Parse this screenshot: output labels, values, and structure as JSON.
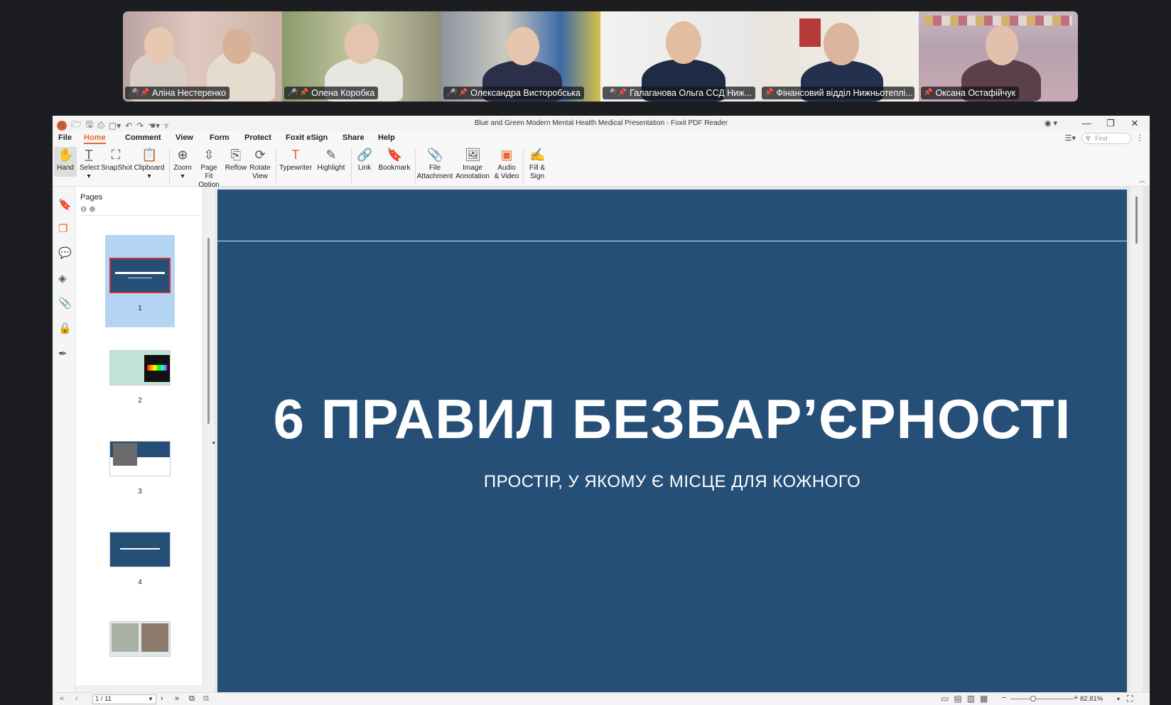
{
  "participants": [
    {
      "name": "Аліна Нестеренко",
      "muted": true
    },
    {
      "name": "Олена Коробка",
      "muted": true
    },
    {
      "name": "Олександра Висторобська",
      "muted": true
    },
    {
      "name": "Галаганова Ольга ССД Ниж...",
      "muted": true
    },
    {
      "name": "Фінансовий відділ Нижньотеплі...",
      "muted": false,
      "active": true
    },
    {
      "name": "Оксана Остафійчук",
      "muted": false
    }
  ],
  "app": {
    "window_title": "Blue and Green Modern Mental Health Medical Presentation - Foxit PDF Reader",
    "menu": [
      "File",
      "Home",
      "Comment",
      "View",
      "Form",
      "Protect",
      "Foxit eSign",
      "Share",
      "Help"
    ],
    "active_menu": "Home",
    "find_placeholder": "Find",
    "tools": {
      "hand": "Hand",
      "select": "Select",
      "snapshot": "SnapShot",
      "clipboard": "Clipboard",
      "zoom": "Zoom",
      "page_fit_1": "Page Fit",
      "page_fit_2": "Option",
      "reflow": "Reflow",
      "rotate_1": "Rotate",
      "rotate_2": "View",
      "typewriter": "Typewriter",
      "highlight": "Highlight",
      "link": "Link",
      "bookmark": "Bookmark",
      "file_attach_1": "File",
      "file_attach_2": "Attachment",
      "image_annot_1": "Image",
      "image_annot_2": "Annotation",
      "audio_1": "Audio",
      "audio_2": "& Video",
      "fill_1": "Fill &",
      "fill_2": "Sign"
    },
    "pages_panel": {
      "title": "Pages",
      "thumbnails": [
        "1",
        "2",
        "3",
        "4"
      ]
    },
    "slide": {
      "title": "6 ПРАВИЛ БЕЗБАР’ЄРНОСТІ",
      "subtitle": "ПРОСТІР, У ЯКОМУ Є МІСЦЕ ДЛЯ КОЖНОГО",
      "bg_color": "#264f78"
    },
    "status": {
      "page_indicator": "1 / 11",
      "zoom": "82.81%"
    }
  },
  "colors": {
    "accent": "#e8692a",
    "active_speaker": "#2fd18e"
  }
}
